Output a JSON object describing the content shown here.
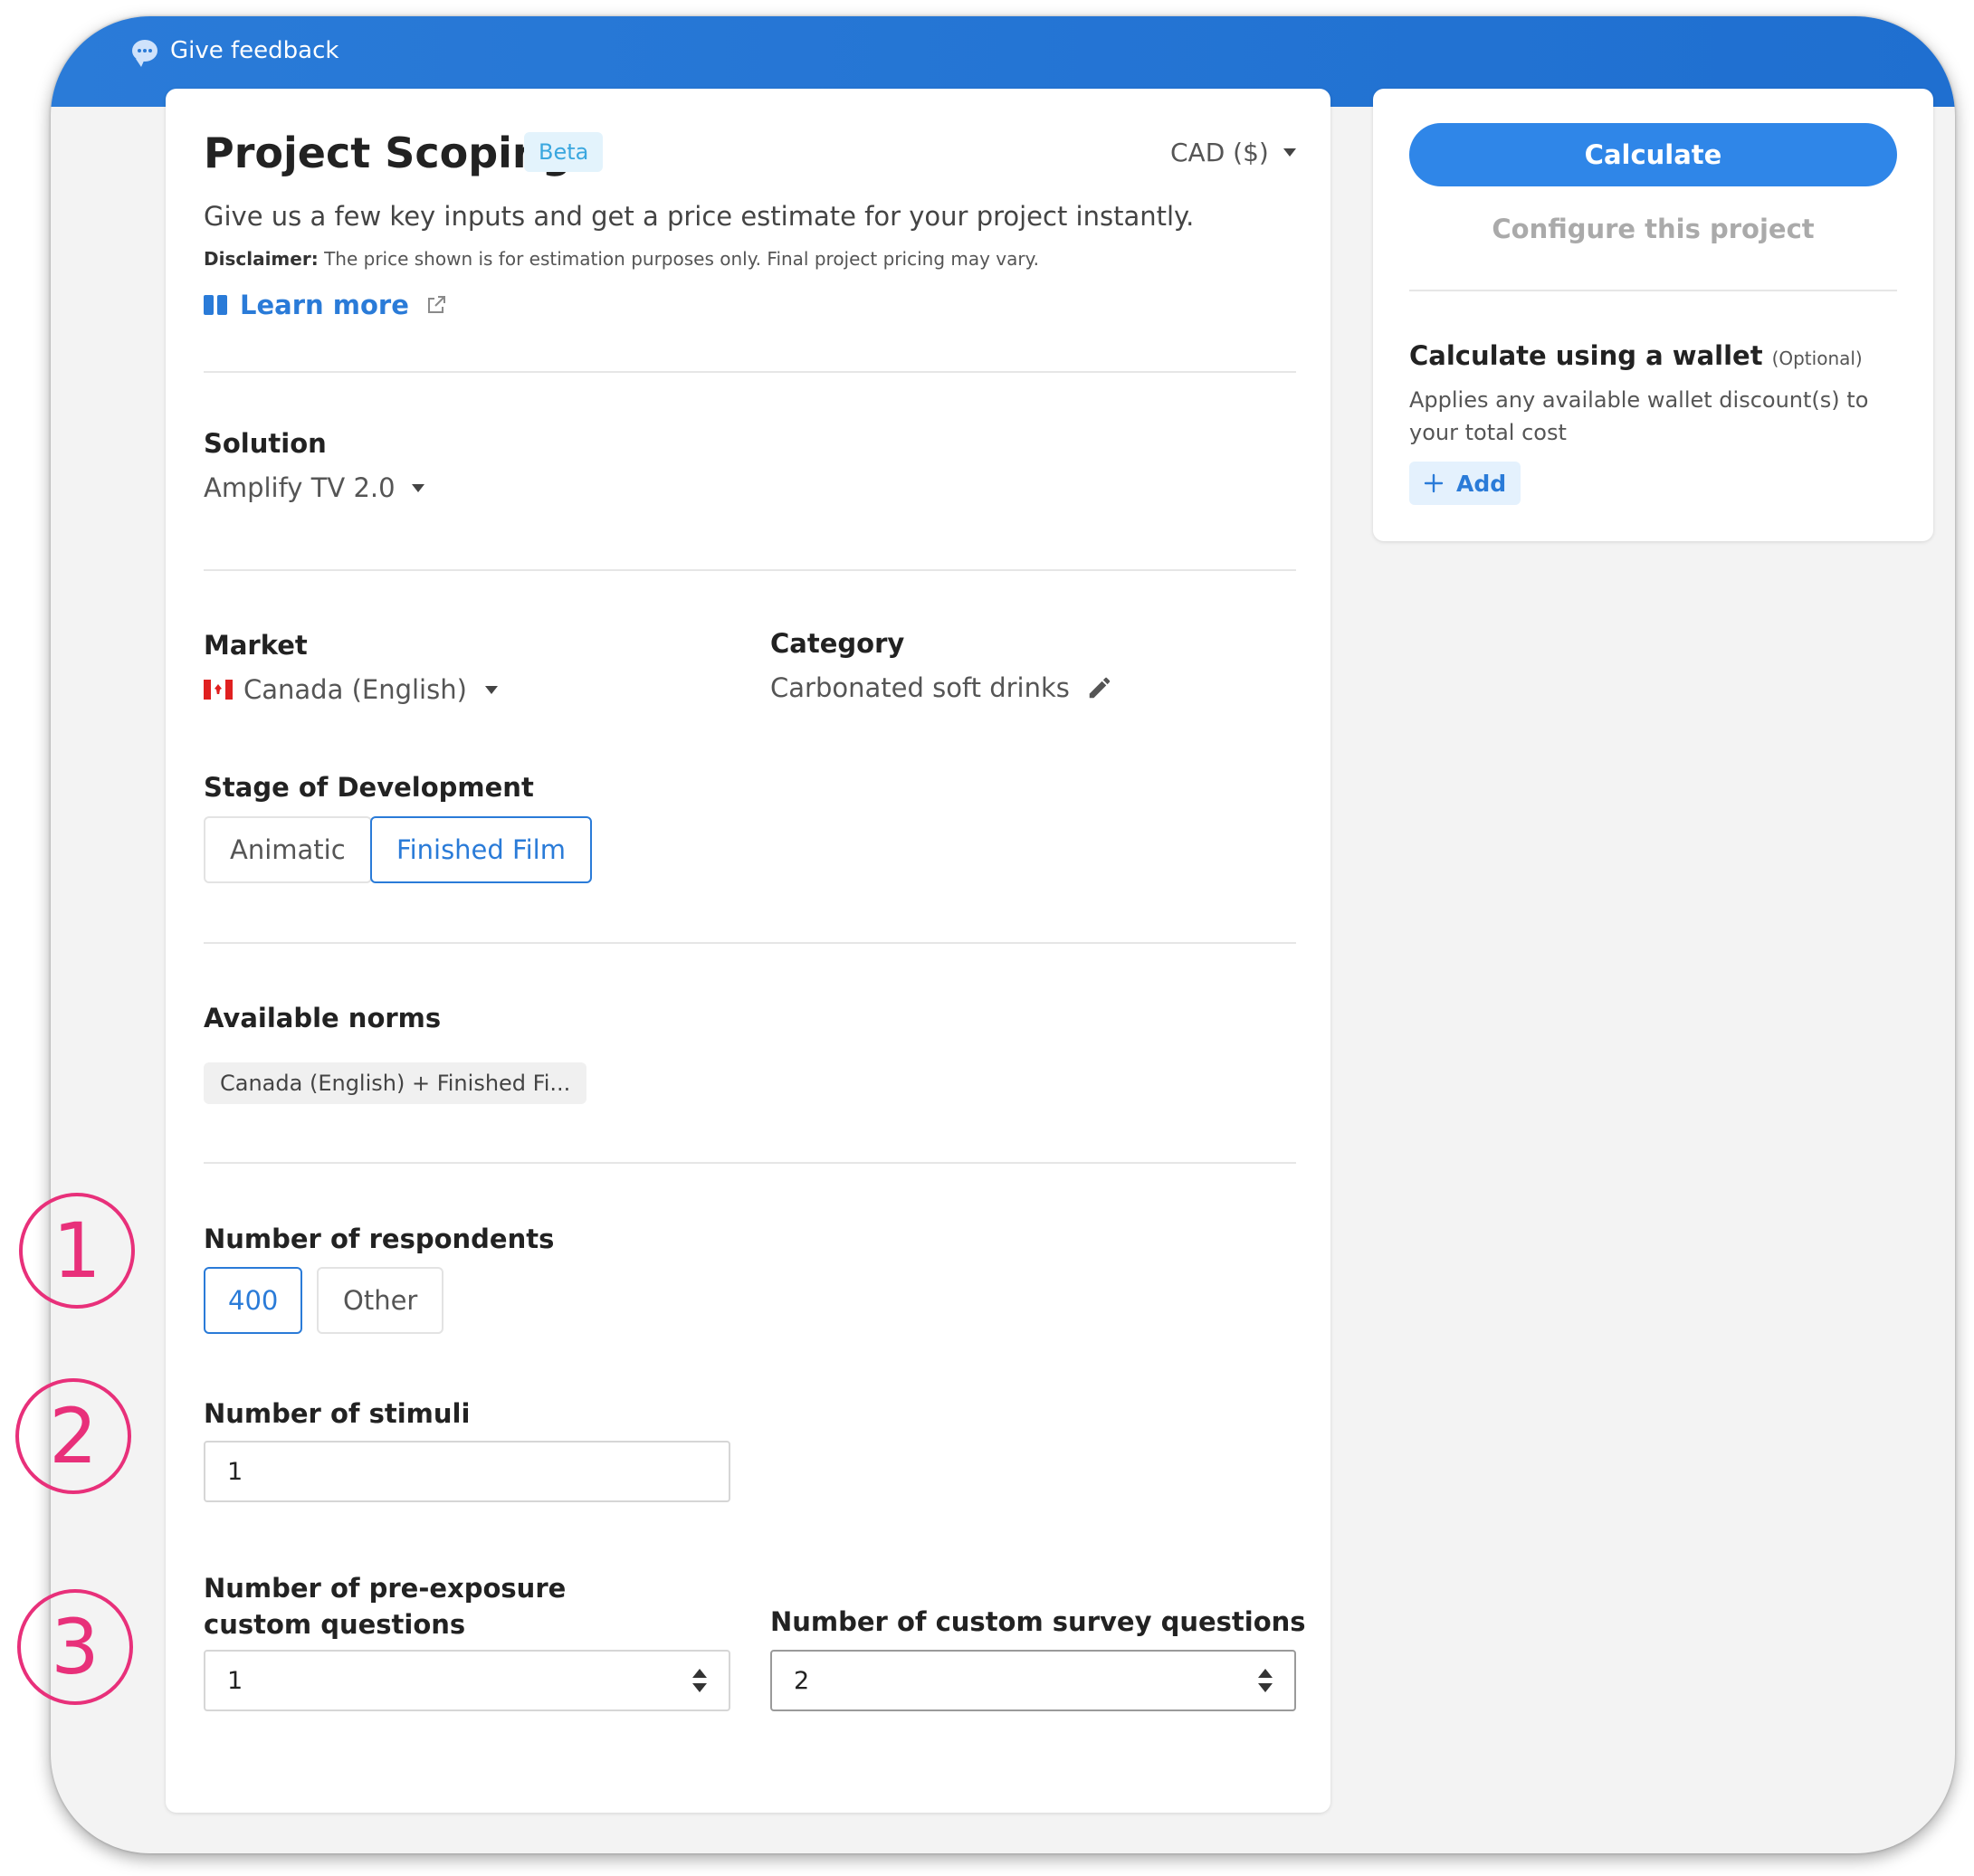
{
  "topbar": {
    "feedback_label": "Give feedback"
  },
  "header": {
    "title": "Project Scoping",
    "badge": "Beta",
    "currency": "CAD ($)",
    "subtitle": "Give us a few key inputs and get a price estimate for your project instantly.",
    "disclaimer_label": "Disclaimer:",
    "disclaimer_text": "The price shown is for estimation purposes only. Final project pricing may vary.",
    "learn_more": "Learn more"
  },
  "solution": {
    "label": "Solution",
    "value": "Amplify TV 2.0"
  },
  "market": {
    "label": "Market",
    "value": "Canada (English)"
  },
  "category": {
    "label": "Category",
    "value": "Carbonated soft drinks"
  },
  "stage": {
    "label": "Stage of Development",
    "options": [
      "Animatic",
      "Finished Film"
    ],
    "selected": "Finished Film"
  },
  "norms": {
    "label": "Available norms",
    "chip": "Canada (English) + Finished Fi..."
  },
  "respondents": {
    "label": "Number of respondents",
    "options": [
      "400",
      "Other"
    ],
    "selected": "400"
  },
  "stimuli": {
    "label": "Number of stimuli",
    "value": "1"
  },
  "pre_exposure": {
    "label": "Number of pre-exposure custom questions",
    "value": "1"
  },
  "custom_survey": {
    "label": "Number of custom survey questions",
    "value": "2"
  },
  "sidebar": {
    "calculate": "Calculate",
    "configure": "Configure this project",
    "wallet_title": "Calculate using a wallet",
    "wallet_optional": "(Optional)",
    "wallet_desc": "Applies any available wallet discount(s) to your total cost",
    "add": "Add"
  },
  "annotations": [
    "1",
    "2",
    "3"
  ],
  "colors": {
    "accent": "#2a7bd8",
    "topbar": "#1f6fd0",
    "annotation": "#e8307a",
    "beta_bg": "#e3f3fc"
  }
}
